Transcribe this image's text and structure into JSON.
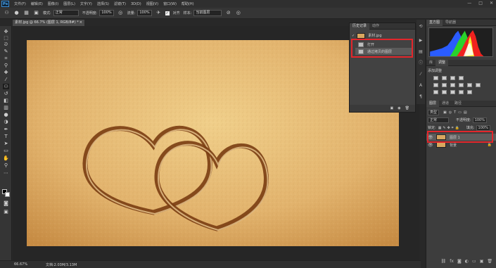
{
  "app": {
    "logo": "Ps"
  },
  "menu": [
    "文件(F)",
    "编辑(E)",
    "图像(I)",
    "图层(L)",
    "文字(Y)",
    "选择(S)",
    "滤镜(T)",
    "3D(D)",
    "视图(V)",
    "窗口(W)",
    "帮助(H)"
  ],
  "window_controls": [
    "—",
    "□",
    "✕"
  ],
  "options": {
    "size_value": "●",
    "mode_label": "模式:",
    "mode_value": "正常",
    "opacity_label": "不透明度:",
    "opacity_value": "100%",
    "flow_label": "流量:",
    "flow_value": "100%",
    "aligned_label": "对齐",
    "sample_label": "样本:",
    "sample_value": "当前图层"
  },
  "document": {
    "tab_title": "素材.jpg @ 66.7% (图层 1, RGB/8#) *",
    "close": "×"
  },
  "status": {
    "zoom": "66.67%",
    "doc_info": "文档:2.03M/3.13M"
  },
  "history_panel": {
    "tabs": [
      "历史记录",
      "动作"
    ],
    "snapshot_label": "素材.jpg",
    "items": [
      "打开",
      "通过拷贝的图层"
    ],
    "bottom_icons": [
      "▣",
      "◉",
      "🗑"
    ]
  },
  "right_panel": {
    "histogram_tabs": [
      "直方图",
      "导航器"
    ],
    "adjust_tabs": [
      "库",
      "调整"
    ],
    "adjust_title": "添加调整",
    "layers_tabs": [
      "图层",
      "通道",
      "路径"
    ],
    "kind_label": "类型",
    "blend_value": "正常",
    "opacity_label": "不透明度:",
    "opacity_value": "100%",
    "lock_label": "锁定:",
    "fill_label": "填充:",
    "fill_value": "100%",
    "layers": [
      {
        "name": "图层 1",
        "selected": true
      },
      {
        "name": "背景",
        "selected": false,
        "lock": "🔒"
      }
    ]
  },
  "colors": {
    "accent_red": "#e3262b",
    "sand": "#d9a75f",
    "ui_dark": "#282828"
  }
}
